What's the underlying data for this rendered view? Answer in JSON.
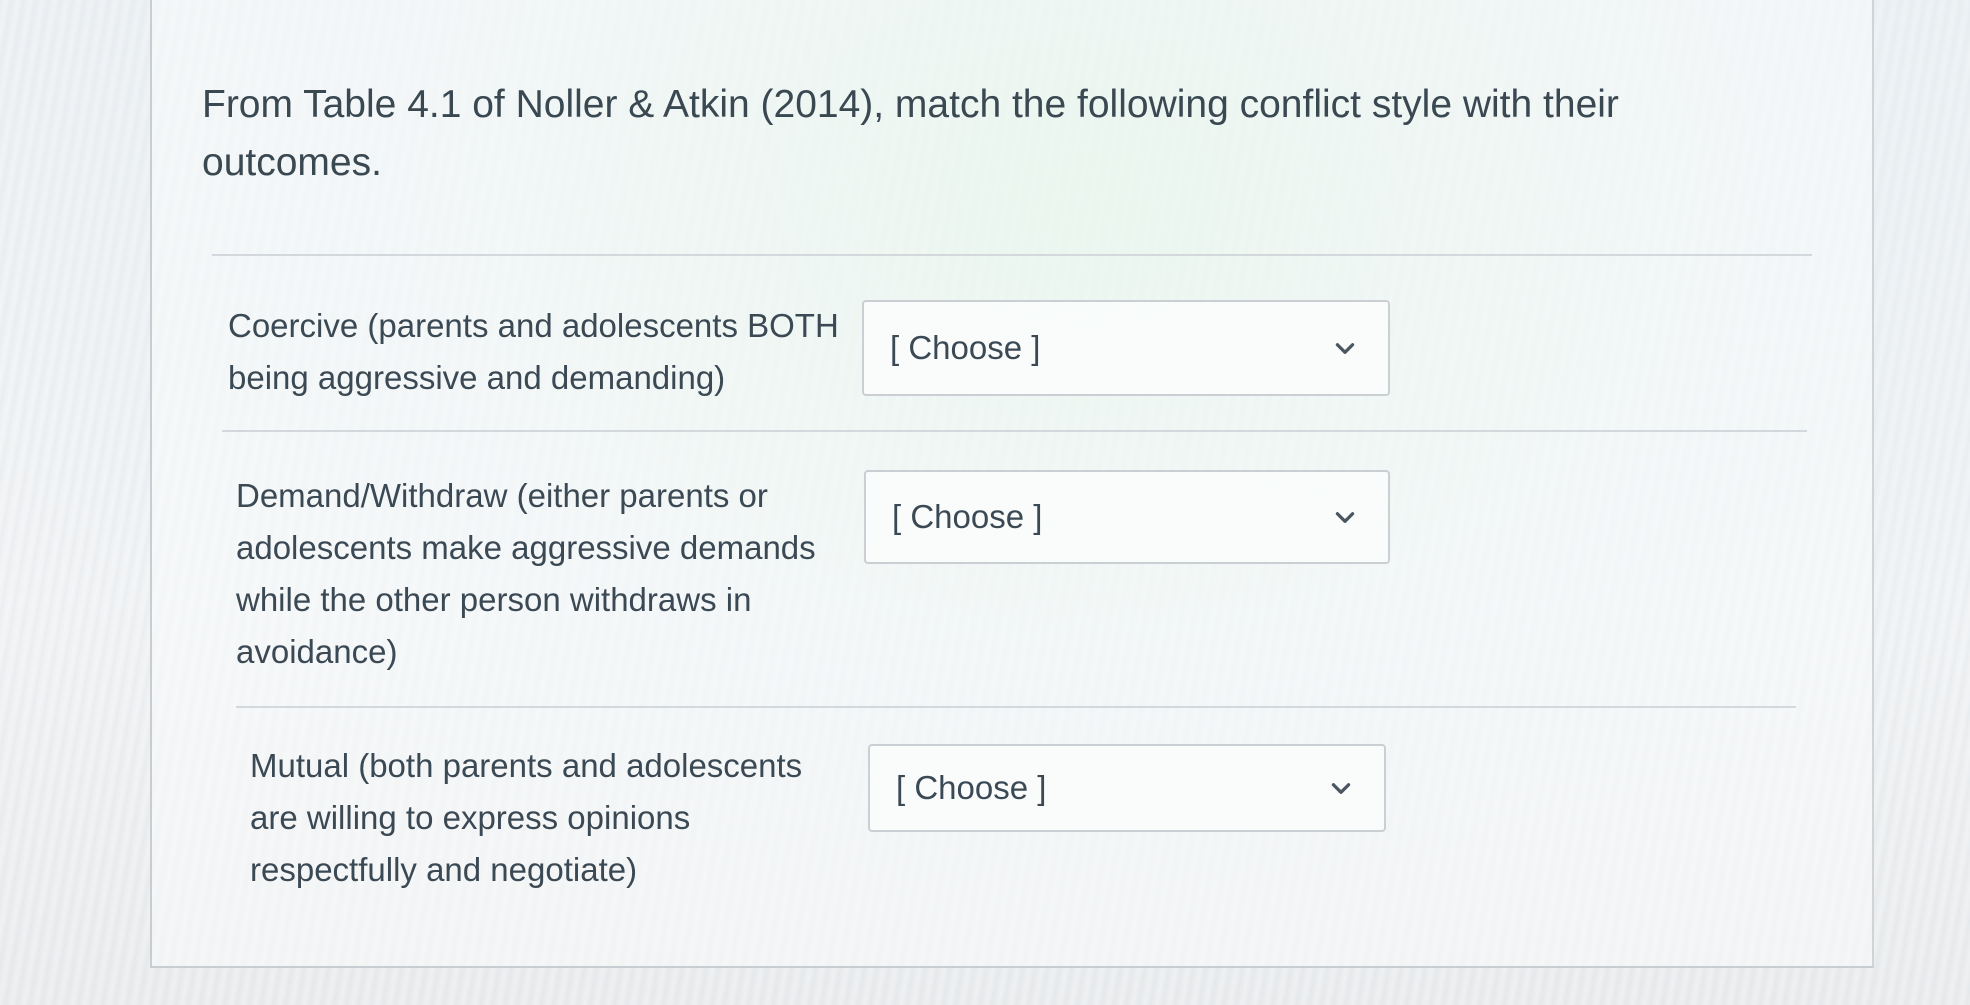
{
  "question": {
    "text": "From Table 4.1 of Noller & Atkin (2014), match the following conflict style with their outcomes."
  },
  "rows": [
    {
      "label": "Coercive (parents and adolescents BOTH being aggressive and demanding)",
      "select_value": "[ Choose ]"
    },
    {
      "label": "Demand/Withdraw (either parents or adolescents make aggressive demands while the other person withdraws in avoidance)",
      "select_value": "[ Choose ]"
    },
    {
      "label": "Mutual (both parents and adolescents are willing to express opinions respectfully and negotiate)",
      "select_value": "[ Choose ]"
    }
  ],
  "icons": {
    "dropdown": "chevron-down-icon"
  }
}
